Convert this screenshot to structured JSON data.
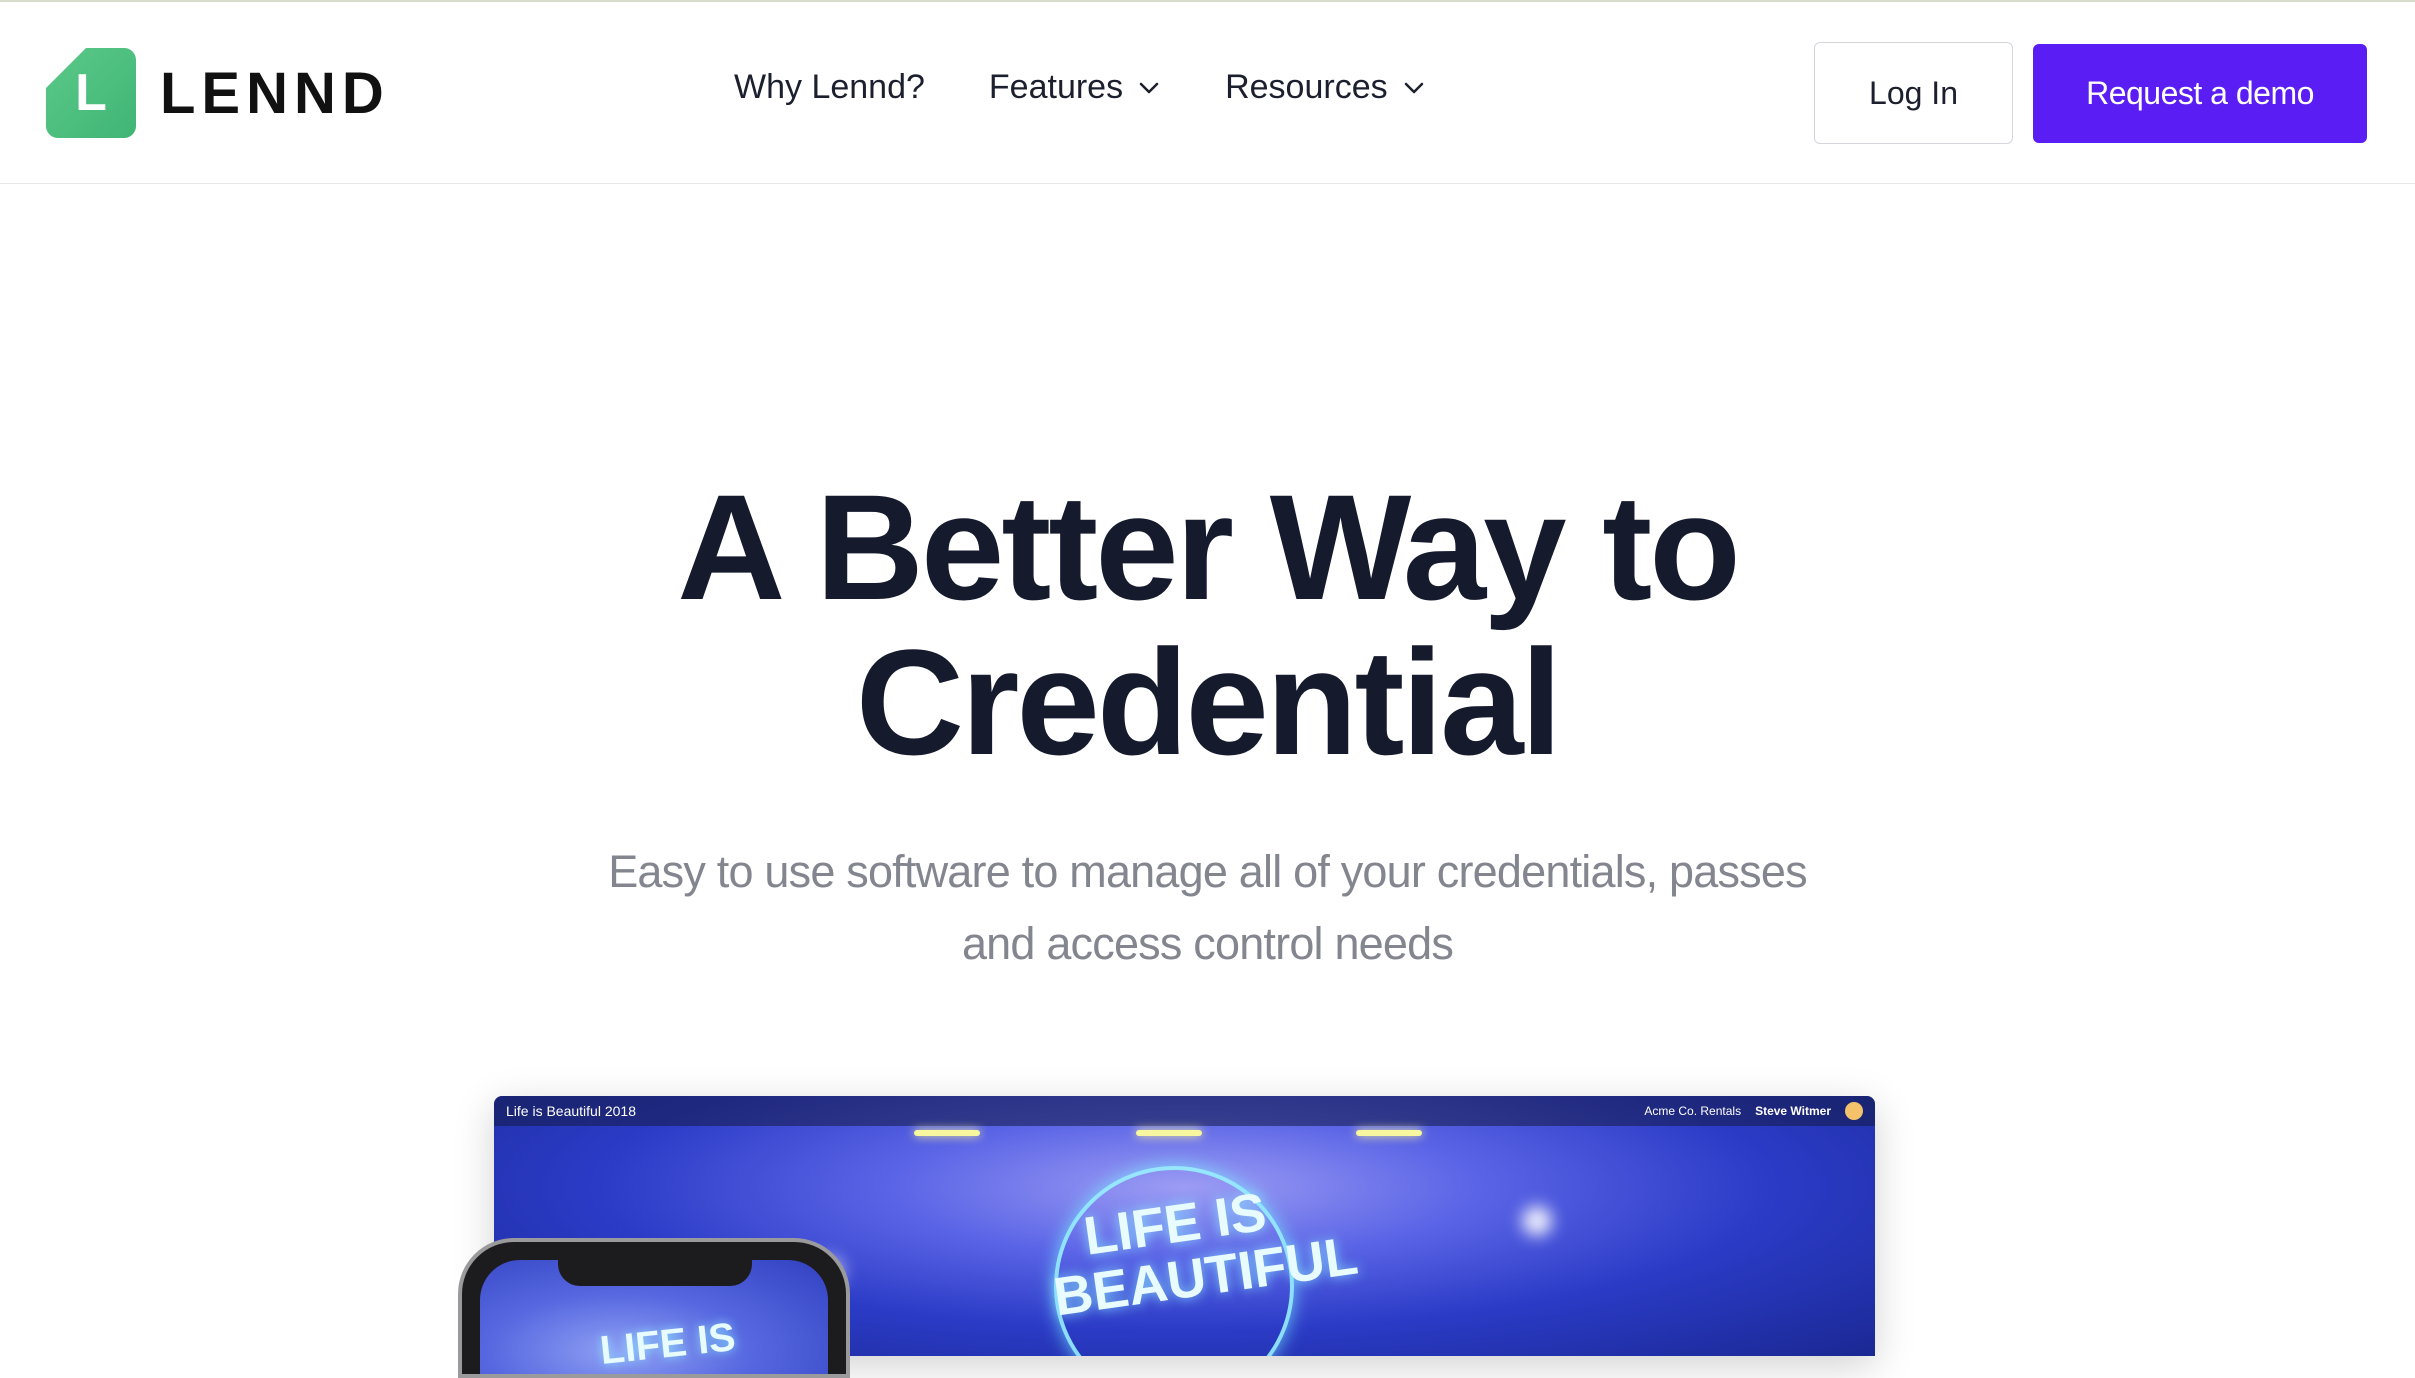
{
  "brand": {
    "logo_letter": "L",
    "name": "LENND",
    "color": "#4cbf7f"
  },
  "nav": {
    "items": [
      {
        "label": "Why Lennd?",
        "has_dropdown": false
      },
      {
        "label": "Features",
        "has_dropdown": true
      },
      {
        "label": "Resources",
        "has_dropdown": true
      }
    ]
  },
  "actions": {
    "login_label": "Log In",
    "demo_label": "Request a demo",
    "accent": "#5a1ef5"
  },
  "hero": {
    "title_line1": "A Better Way to",
    "title_line2": "Credential",
    "subtitle_line1": "Easy to use software to manage all of your credentials, passes",
    "subtitle_line2": "and access control needs"
  },
  "mockup": {
    "event_name": "Life is Beautiful 2018",
    "org_name": "Acme Co. Rentals",
    "user_name": "Steve Witmer",
    "neon_line1": "LIFE IS",
    "neon_line2": "BEAUTIFUL",
    "phone_text": "LIFE IS"
  }
}
